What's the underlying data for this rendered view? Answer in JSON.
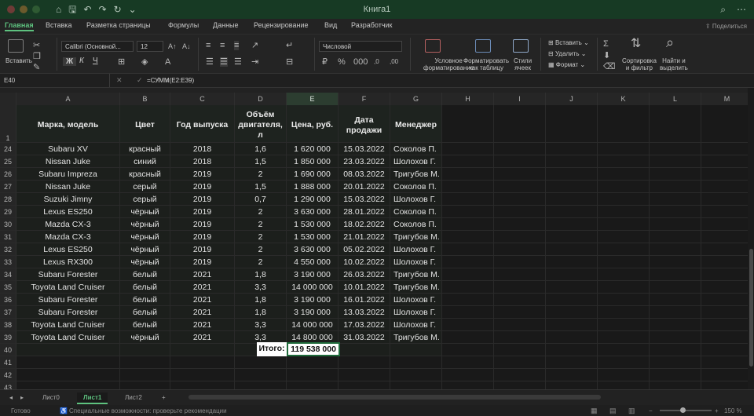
{
  "window": {
    "title": "Книга1"
  },
  "quick_access": [
    "⌂",
    "🖫",
    "↶",
    "↷",
    "↻",
    "⌄"
  ],
  "ribbon_tabs": [
    "Главная",
    "Вставка",
    "Разметка страницы",
    "Формулы",
    "Данные",
    "Рецензирование",
    "Вид",
    "Разработчик"
  ],
  "share_label": "Поделиться",
  "ribbon": {
    "paste": "Вставить",
    "font_name": "Calibri (Основной...",
    "font_size": "12",
    "bold": "Ж",
    "italic": "К",
    "underline": "Ч",
    "number_format": "Числовой",
    "cond_format": [
      "Условное",
      "форматирование"
    ],
    "format_table": [
      "Форматировать",
      "как таблицу"
    ],
    "cell_styles": [
      "Стили",
      "ячеек"
    ],
    "insert": "Вставить",
    "delete": "Удалить",
    "format": "Формат",
    "sort_filter": [
      "Сортировка",
      "и фильтр"
    ],
    "find_select": [
      "Найти и",
      "выделить"
    ]
  },
  "formula_bar": {
    "cell_ref": "E40",
    "fx": "✕ ✓ fx",
    "formula": "=СУММ(E2:E39)"
  },
  "columns": [
    "A",
    "B",
    "C",
    "D",
    "E",
    "F",
    "G",
    "H",
    "I",
    "J",
    "K",
    "L",
    "M"
  ],
  "header_row": {
    "num": "1",
    "cells": [
      "Марка, модель",
      "Цвет",
      "Год выпуска",
      "Объём двигателя, л",
      "Цена, руб.",
      "Дата продажи",
      "Менеджер"
    ]
  },
  "rows": [
    {
      "num": "24",
      "cells": [
        "Subaru XV",
        "красный",
        "2018",
        "1,6",
        "1 620 000",
        "15.03.2022",
        "Соколов П."
      ]
    },
    {
      "num": "25",
      "cells": [
        "Nissan Juke",
        "синий",
        "2018",
        "1,5",
        "1 850 000",
        "23.03.2022",
        "Шолохов Г."
      ]
    },
    {
      "num": "26",
      "cells": [
        "Subaru Impreza",
        "красный",
        "2019",
        "2",
        "1 690 000",
        "08.03.2022",
        "Тригубов М."
      ]
    },
    {
      "num": "27",
      "cells": [
        "Nissan Juke",
        "серый",
        "2019",
        "1,5",
        "1 888 000",
        "20.01.2022",
        "Соколов П."
      ]
    },
    {
      "num": "28",
      "cells": [
        "Suzuki Jimny",
        "серый",
        "2019",
        "0,7",
        "1 290 000",
        "15.03.2022",
        "Шолохов Г."
      ]
    },
    {
      "num": "29",
      "cells": [
        "Lexus ES250",
        "чёрный",
        "2019",
        "2",
        "3 630 000",
        "28.01.2022",
        "Соколов П."
      ]
    },
    {
      "num": "30",
      "cells": [
        "Mazda CX-3",
        "чёрный",
        "2019",
        "2",
        "1 530 000",
        "18.02.2022",
        "Соколов П."
      ]
    },
    {
      "num": "31",
      "cells": [
        "Mazda CX-3",
        "чёрный",
        "2019",
        "2",
        "1 530 000",
        "21.01.2022",
        "Тригубов М."
      ]
    },
    {
      "num": "32",
      "cells": [
        "Lexus ES250",
        "чёрный",
        "2019",
        "2",
        "3 630 000",
        "05.02.2022",
        "Шолохов Г."
      ]
    },
    {
      "num": "33",
      "cells": [
        "Lexus RX300",
        "чёрный",
        "2019",
        "2",
        "4 550 000",
        "10.02.2022",
        "Шолохов Г."
      ]
    },
    {
      "num": "34",
      "cells": [
        "Subaru Forester",
        "белый",
        "2021",
        "1,8",
        "3 190 000",
        "26.03.2022",
        "Тригубов М."
      ]
    },
    {
      "num": "35",
      "cells": [
        "Toyota Land Cruiser",
        "белый",
        "2021",
        "3,3",
        "14 000 000",
        "10.01.2022",
        "Тригубов М."
      ]
    },
    {
      "num": "36",
      "cells": [
        "Subaru Forester",
        "белый",
        "2021",
        "1,8",
        "3 190 000",
        "16.01.2022",
        "Шолохов Г."
      ]
    },
    {
      "num": "37",
      "cells": [
        "Subaru Forester",
        "белый",
        "2021",
        "1,8",
        "3 190 000",
        "13.03.2022",
        "Шолохов Г."
      ]
    },
    {
      "num": "38",
      "cells": [
        "Toyota Land Cruiser",
        "белый",
        "2021",
        "3,3",
        "14 000 000",
        "17.03.2022",
        "Шолохов Г."
      ]
    },
    {
      "num": "39",
      "cells": [
        "Toyota Land Cruiser",
        "чёрный",
        "2021",
        "3,3",
        "14 800 000",
        "31.03.2022",
        "Тригубов М."
      ]
    }
  ],
  "total": {
    "row_num": "40",
    "label": "Итого:",
    "value": "119 538 000"
  },
  "empty_rows": [
    "41",
    "42",
    "43"
  ],
  "sheet_tabs": [
    "Лист0",
    "Лист1",
    "Лист2"
  ],
  "active_sheet": "Лист1",
  "add_sheet": "+",
  "status": {
    "ready": "Готово",
    "accessibility": "Специальные возможности: проверьте рекомендации",
    "zoom": "150 %"
  },
  "colors": {
    "accent": "#5ec27f",
    "titlebar": "#173a24",
    "selection": "#1f6b3b"
  }
}
